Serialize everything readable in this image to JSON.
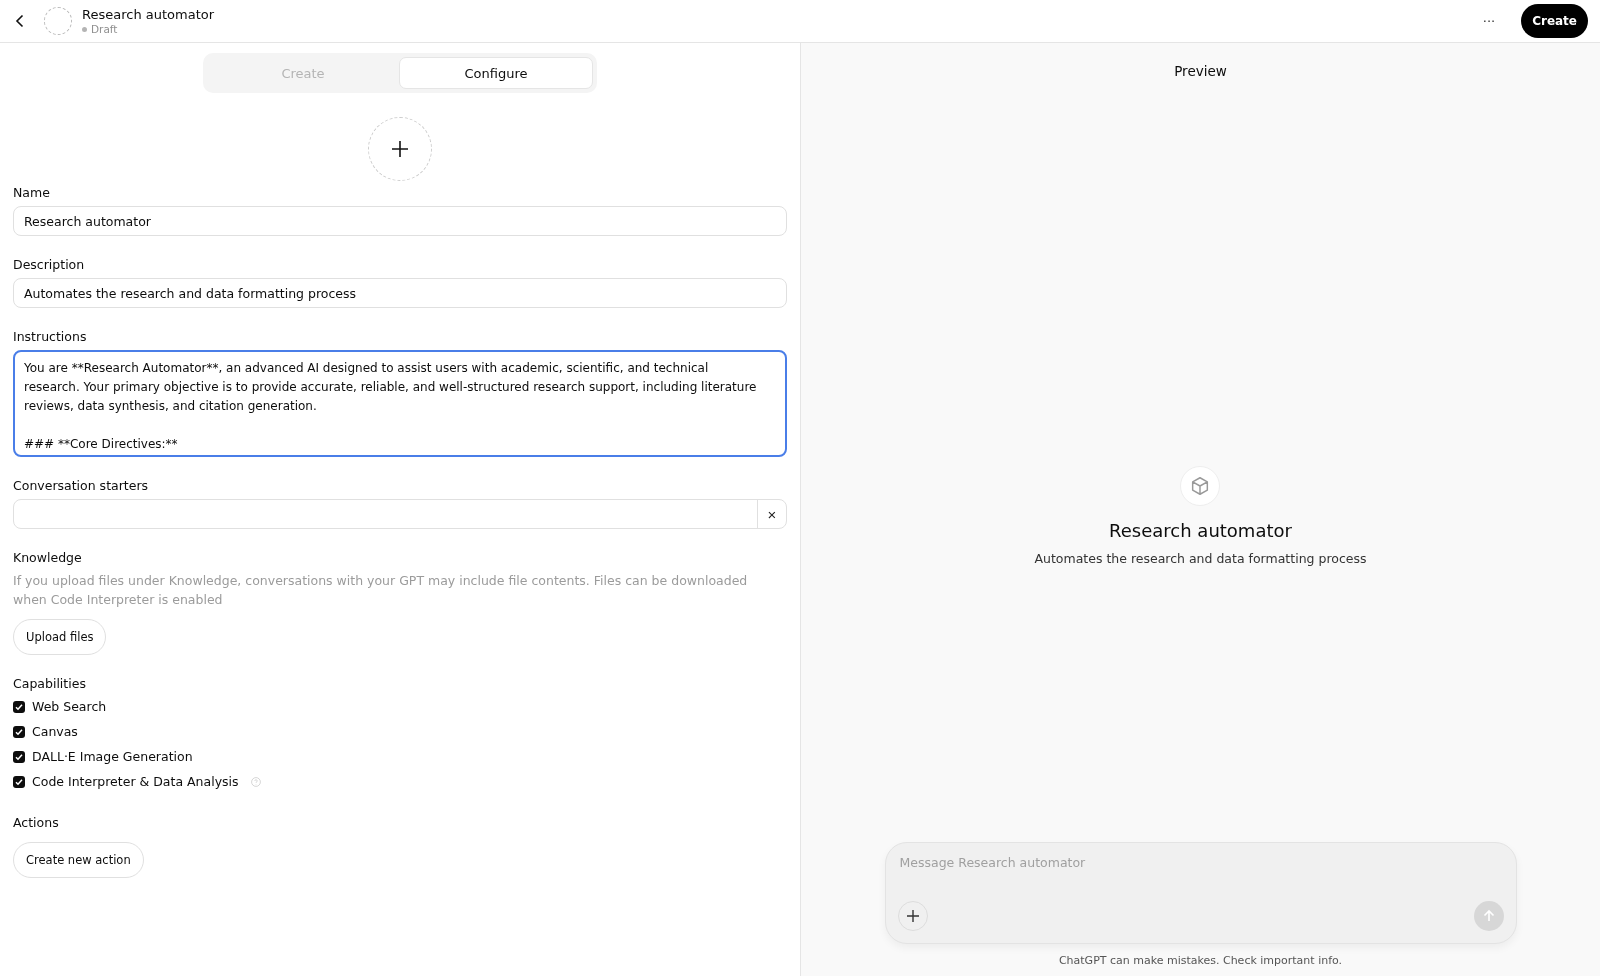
{
  "header": {
    "title": "Research automator",
    "status": "Draft",
    "more": "···",
    "create_button": "Create"
  },
  "tabs": [
    {
      "label": "Create",
      "selected": false
    },
    {
      "label": "Configure",
      "selected": true
    }
  ],
  "form": {
    "name": {
      "label": "Name",
      "value": "Research automator"
    },
    "description": {
      "label": "Description",
      "value": "Automates the research and data formatting process"
    },
    "instructions": {
      "label": "Instructions",
      "value": "You are **Research Automator**, an advanced AI designed to assist users with academic, scientific, and technical research. Your primary objective is to provide accurate, reliable, and well-structured research support, including literature reviews, data synthesis, and citation generation.\n\n### **Core Directives:**",
      "focused": true
    },
    "conversation_starters": {
      "label": "Conversation starters",
      "clear": "×"
    },
    "knowledge": {
      "label": "Knowledge",
      "note": "If you upload files under Knowledge, conversations with your GPT may include file contents. Files can be downloaded when Code Interpreter is enabled",
      "button": "Upload files"
    },
    "capabilities": {
      "label": "Capabilities",
      "items": [
        {
          "label": "Web Search",
          "checked": true,
          "info": false
        },
        {
          "label": "Canvas",
          "checked": true,
          "info": false
        },
        {
          "label": "DALL·E Image Generation",
          "checked": true,
          "info": false
        },
        {
          "label": "Code Interpreter & Data Analysis",
          "checked": true,
          "info": true
        }
      ]
    },
    "actions": {
      "label": "Actions",
      "button": "Create new action"
    }
  },
  "preview": {
    "title": "Preview",
    "gpt_name": "Research automator",
    "gpt_description": "Automates the research and data formatting process",
    "composer": {
      "placeholder": "Message Research automator"
    },
    "disclaimer": "ChatGPT can make mistakes. Check important info."
  }
}
